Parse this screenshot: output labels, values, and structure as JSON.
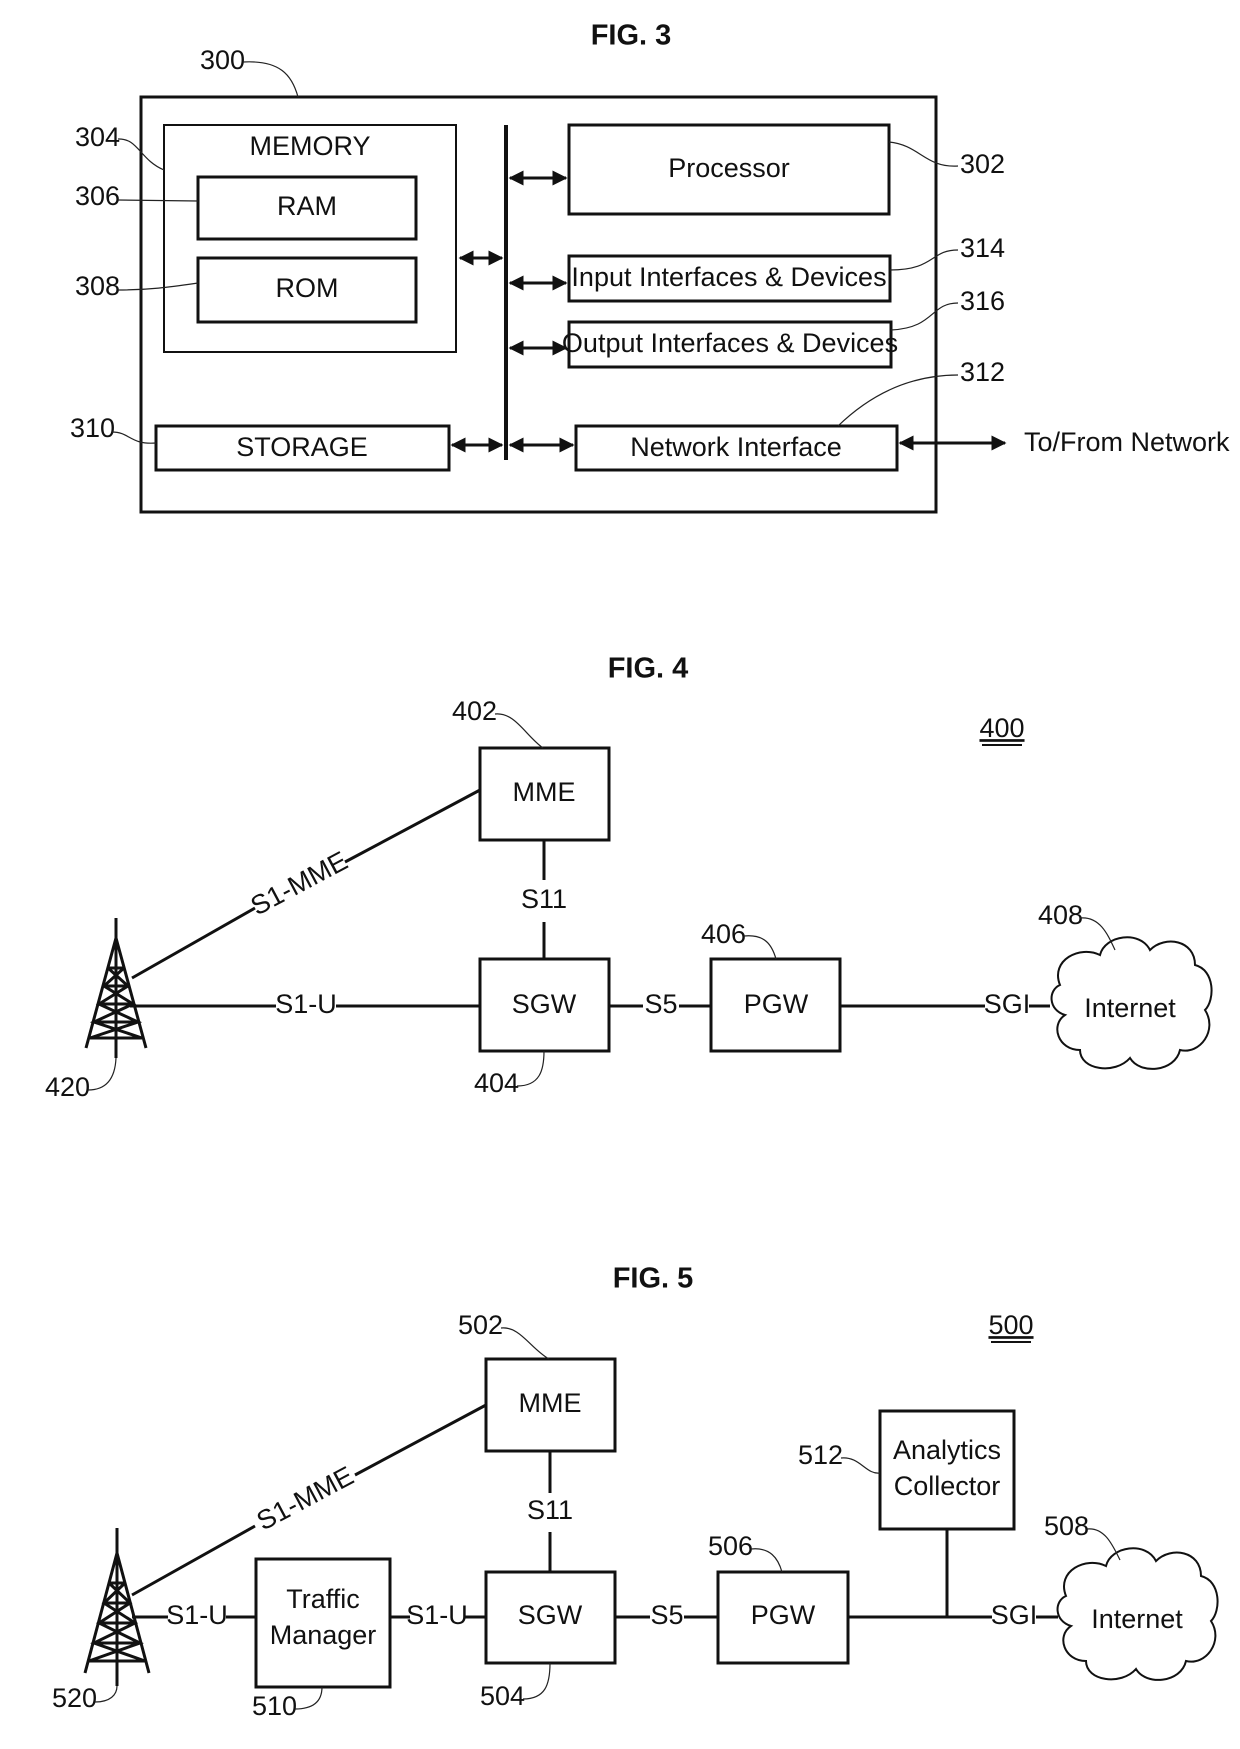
{
  "fig3": {
    "title": "FIG. 3",
    "ref_system": "300",
    "memory": {
      "label": "MEMORY",
      "ref": "304"
    },
    "ram": {
      "label": "RAM",
      "ref": "306"
    },
    "rom": {
      "label": "ROM",
      "ref": "308"
    },
    "storage": {
      "label": "STORAGE",
      "ref": "310"
    },
    "processor": {
      "label": "Processor",
      "ref": "302"
    },
    "input": {
      "label": "Input Interfaces & Devices",
      "ref": "314"
    },
    "output": {
      "label": "Output Interfaces & Devices",
      "ref": "316"
    },
    "network_interface": {
      "label": "Network Interface",
      "ref": "312"
    },
    "external": "To/From Network"
  },
  "fig4": {
    "title": "FIG. 4",
    "system_ref": "400",
    "mme": {
      "label": "MME",
      "ref": "402"
    },
    "sgw": {
      "label": "SGW",
      "ref": "404"
    },
    "pgw": {
      "label": "PGW",
      "ref": "406"
    },
    "internet": {
      "label": "Internet",
      "ref": "408"
    },
    "tower": {
      "ref": "420"
    },
    "links": {
      "s1_mme": "S1-MME",
      "s1_u": "S1-U",
      "s11": "S11",
      "s5": "S5",
      "sgi": "SGI"
    }
  },
  "fig5": {
    "title": "FIG. 5",
    "system_ref": "500",
    "mme": {
      "label": "MME",
      "ref": "502"
    },
    "sgw": {
      "label": "SGW",
      "ref": "504"
    },
    "pgw": {
      "label": "PGW",
      "ref": "506"
    },
    "internet": {
      "label": "Internet",
      "ref": "508"
    },
    "traffic_manager": {
      "label_line1": "Traffic",
      "label_line2": "Manager",
      "ref": "510"
    },
    "analytics": {
      "label_line1": "Analytics",
      "label_line2": "Collector",
      "ref": "512"
    },
    "tower": {
      "ref": "520"
    },
    "links": {
      "s1_mme": "S1-MME",
      "s1_u_a": "S1-U",
      "s1_u_b": "S1-U",
      "s11": "S11",
      "s5": "S5",
      "sgi": "SGI"
    }
  }
}
